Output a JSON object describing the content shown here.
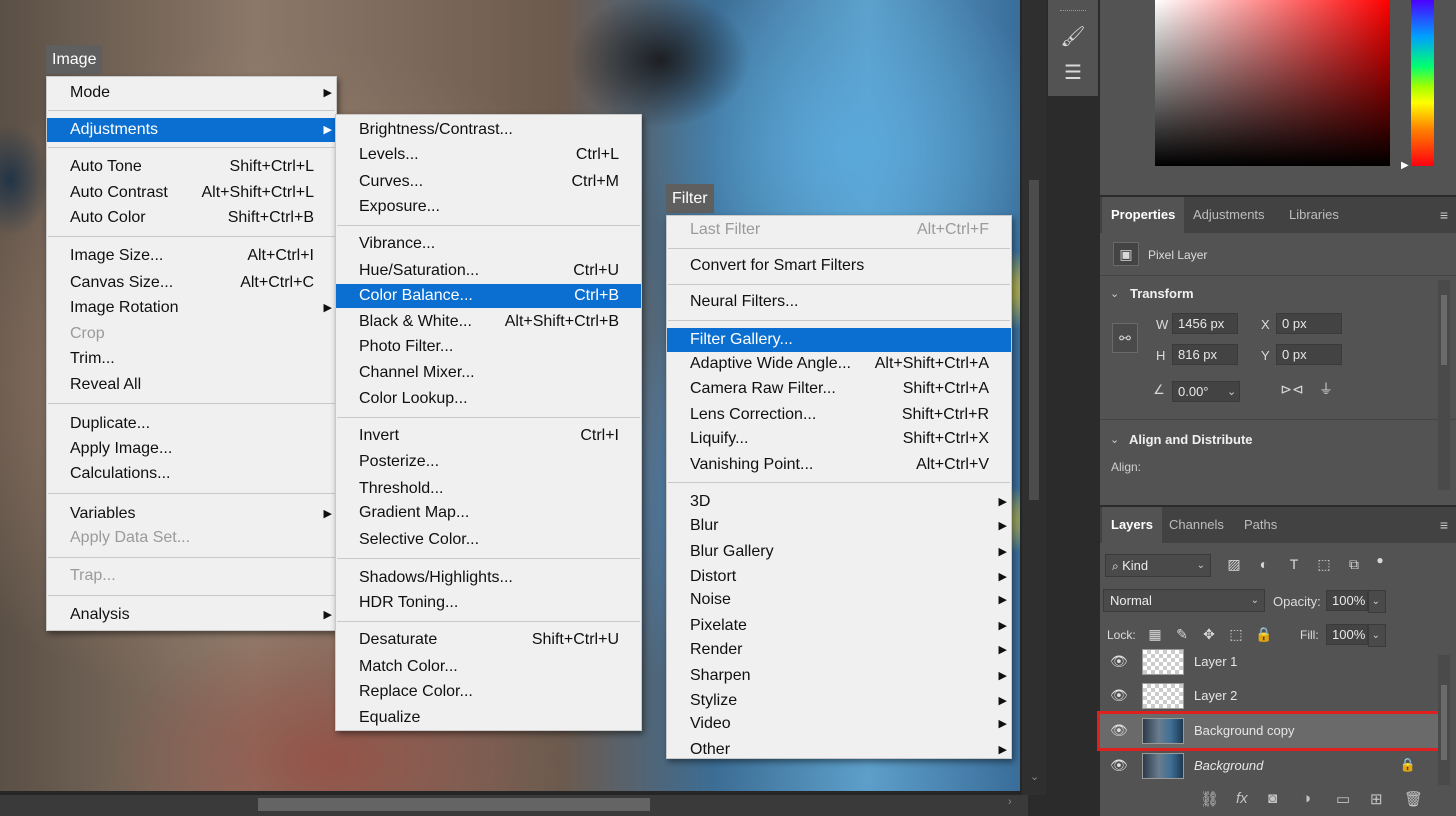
{
  "image_menu": {
    "title": "Image",
    "items": [
      {
        "label": "Mode",
        "shortcut": "",
        "submenu": true
      },
      {
        "label": "Adjustments",
        "shortcut": "",
        "submenu": true,
        "highlighted": true
      },
      {
        "label": "Auto Tone",
        "shortcut": "Shift+Ctrl+L"
      },
      {
        "label": "Auto Contrast",
        "shortcut": "Alt+Shift+Ctrl+L"
      },
      {
        "label": "Auto Color",
        "shortcut": "Shift+Ctrl+B"
      },
      {
        "label": "Image Size...",
        "shortcut": "Alt+Ctrl+I"
      },
      {
        "label": "Canvas Size...",
        "shortcut": "Alt+Ctrl+C"
      },
      {
        "label": "Image Rotation",
        "shortcut": "",
        "submenu": true
      },
      {
        "label": "Crop",
        "shortcut": "",
        "disabled": true
      },
      {
        "label": "Trim...",
        "shortcut": ""
      },
      {
        "label": "Reveal All",
        "shortcut": ""
      },
      {
        "label": "Duplicate...",
        "shortcut": ""
      },
      {
        "label": "Apply Image...",
        "shortcut": ""
      },
      {
        "label": "Calculations...",
        "shortcut": ""
      },
      {
        "label": "Variables",
        "shortcut": "",
        "submenu": true
      },
      {
        "label": "Apply Data Set...",
        "shortcut": "",
        "disabled": true
      },
      {
        "label": "Trap...",
        "shortcut": "",
        "disabled": true
      },
      {
        "label": "Analysis",
        "shortcut": "",
        "submenu": true
      }
    ]
  },
  "adjustments_menu": {
    "items": [
      {
        "label": "Brightness/Contrast...",
        "shortcut": ""
      },
      {
        "label": "Levels...",
        "shortcut": "Ctrl+L"
      },
      {
        "label": "Curves...",
        "shortcut": "Ctrl+M"
      },
      {
        "label": "Exposure...",
        "shortcut": ""
      },
      {
        "label": "Vibrance...",
        "shortcut": ""
      },
      {
        "label": "Hue/Saturation...",
        "shortcut": "Ctrl+U"
      },
      {
        "label": "Color Balance...",
        "shortcut": "Ctrl+B",
        "highlighted": true
      },
      {
        "label": "Black & White...",
        "shortcut": "Alt+Shift+Ctrl+B"
      },
      {
        "label": "Photo Filter...",
        "shortcut": ""
      },
      {
        "label": "Channel Mixer...",
        "shortcut": ""
      },
      {
        "label": "Color Lookup...",
        "shortcut": ""
      },
      {
        "label": "Invert",
        "shortcut": "Ctrl+I"
      },
      {
        "label": "Posterize...",
        "shortcut": ""
      },
      {
        "label": "Threshold...",
        "shortcut": ""
      },
      {
        "label": "Gradient Map...",
        "shortcut": ""
      },
      {
        "label": "Selective Color...",
        "shortcut": ""
      },
      {
        "label": "Shadows/Highlights...",
        "shortcut": ""
      },
      {
        "label": "HDR Toning...",
        "shortcut": ""
      },
      {
        "label": "Desaturate",
        "shortcut": "Shift+Ctrl+U"
      },
      {
        "label": "Match Color...",
        "shortcut": ""
      },
      {
        "label": "Replace Color...",
        "shortcut": ""
      },
      {
        "label": "Equalize",
        "shortcut": ""
      }
    ]
  },
  "filter_menu": {
    "title": "Filter",
    "items": [
      {
        "label": "Last Filter",
        "shortcut": "Alt+Ctrl+F",
        "disabled": true
      },
      {
        "label": "Convert for Smart Filters",
        "shortcut": ""
      },
      {
        "label": "Neural Filters...",
        "shortcut": ""
      },
      {
        "label": "Filter Gallery...",
        "shortcut": "",
        "highlighted": true
      },
      {
        "label": "Adaptive Wide Angle...",
        "shortcut": "Alt+Shift+Ctrl+A"
      },
      {
        "label": "Camera Raw Filter...",
        "shortcut": "Shift+Ctrl+A"
      },
      {
        "label": "Lens Correction...",
        "shortcut": "Shift+Ctrl+R"
      },
      {
        "label": "Liquify...",
        "shortcut": "Shift+Ctrl+X"
      },
      {
        "label": "Vanishing Point...",
        "shortcut": "Alt+Ctrl+V"
      },
      {
        "label": "3D",
        "shortcut": "",
        "submenu": true
      },
      {
        "label": "Blur",
        "shortcut": "",
        "submenu": true
      },
      {
        "label": "Blur Gallery",
        "shortcut": "",
        "submenu": true
      },
      {
        "label": "Distort",
        "shortcut": "",
        "submenu": true
      },
      {
        "label": "Noise",
        "shortcut": "",
        "submenu": true
      },
      {
        "label": "Pixelate",
        "shortcut": "",
        "submenu": true
      },
      {
        "label": "Render",
        "shortcut": "",
        "submenu": true
      },
      {
        "label": "Sharpen",
        "shortcut": "",
        "submenu": true
      },
      {
        "label": "Stylize",
        "shortcut": "",
        "submenu": true
      },
      {
        "label": "Video",
        "shortcut": "",
        "submenu": true
      },
      {
        "label": "Other",
        "shortcut": "",
        "submenu": true
      }
    ]
  },
  "properties_panel": {
    "tabs": [
      "Properties",
      "Adjustments",
      "Libraries"
    ],
    "layer_kind": "Pixel Layer",
    "transform_title": "Transform",
    "w_label": "W",
    "w_value": "1456 px",
    "h_label": "H",
    "h_value": "816 px",
    "x_label": "X",
    "x_value": "0 px",
    "y_label": "Y",
    "y_value": "0 px",
    "angle_value": "0.00°",
    "align_title": "Align and Distribute",
    "align_label": "Align:"
  },
  "layers_panel": {
    "tabs": [
      "Layers",
      "Channels",
      "Paths"
    ],
    "filter_kind": "Kind",
    "blend_mode": "Normal",
    "opacity_label": "Opacity:",
    "opacity_value": "100%",
    "lock_label": "Lock:",
    "fill_label": "Fill:",
    "fill_value": "100%",
    "layers": [
      {
        "name": "Layer 1",
        "thumb": "transparent"
      },
      {
        "name": "Layer 2",
        "thumb": "transparent"
      },
      {
        "name": "Background copy",
        "thumb": "photo",
        "selected": true
      },
      {
        "name": "Background",
        "thumb": "photo",
        "locked": true
      }
    ]
  },
  "colors": {
    "menu_highlight": "#0a6fd1",
    "selection_outline": "#e0201f"
  }
}
